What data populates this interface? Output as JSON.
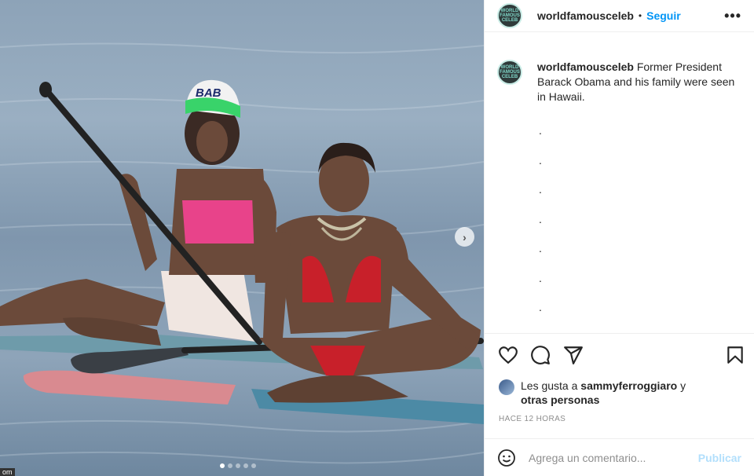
{
  "post": {
    "username": "worldfamousceleb",
    "separator": "•",
    "follow_label": "Seguir",
    "more_label": "•••",
    "avatar_text": "WORLD FAMOUS CELEB",
    "caption_user": "worldfamousceleb",
    "caption_body": "Former President Barack Obama and his family were seen in Hawaii.",
    "caption_dots": [
      ".",
      ".",
      ".",
      ".",
      ".",
      ".",
      "."
    ],
    "likes_prefix": "Les gusta a",
    "likes_user": "sammyferroggiaro",
    "likes_suffix": "y",
    "likes_others": "otras personas",
    "timestamp": "HACE 12 HORAS",
    "comment_placeholder": "Agrega un comentario...",
    "publish_label": "Publicar",
    "next_label": "›",
    "cap_text": "BAB",
    "corner_label": "om"
  },
  "carousel": {
    "total": 5,
    "active": 0
  },
  "colors": {
    "accent": "#0095f6",
    "publish_disabled": "#b2dffc",
    "muted": "#8e8e8e"
  },
  "icons": [
    "heart-icon",
    "comment-icon",
    "share-icon",
    "bookmark-icon",
    "emoji-icon",
    "chevron-right-icon",
    "more-icon"
  ]
}
